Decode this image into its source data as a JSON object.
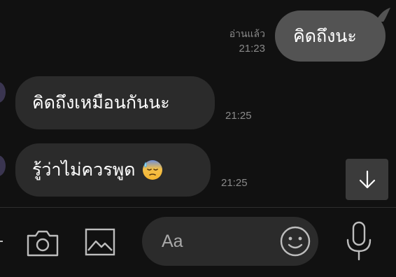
{
  "chat": {
    "outgoing": [
      {
        "text": "คิดถึงนะ",
        "status": "อ่านแล้ว",
        "time": "21:23"
      }
    ],
    "incoming": [
      {
        "text": "คิดถึงเหมือนกันนะ",
        "time": "21:25"
      },
      {
        "text": "รู้ว่าไม่ควรพูด",
        "time": "21:25",
        "emoji": "downcast-face-with-sweat"
      }
    ]
  },
  "composer": {
    "placeholder": "Aa"
  },
  "icons": {
    "scroll_down": "arrow-down-icon",
    "camera": "camera-icon",
    "gallery": "image-icon",
    "emoji": "smiley-icon",
    "mic": "microphone-icon",
    "plus": "plus-icon"
  },
  "colors": {
    "background": "#111111",
    "outgoing_bubble": "#535353",
    "incoming_bubble": "#2b2b2b",
    "meta_text": "#8a8a8a",
    "icon": "#bdbdbd"
  }
}
